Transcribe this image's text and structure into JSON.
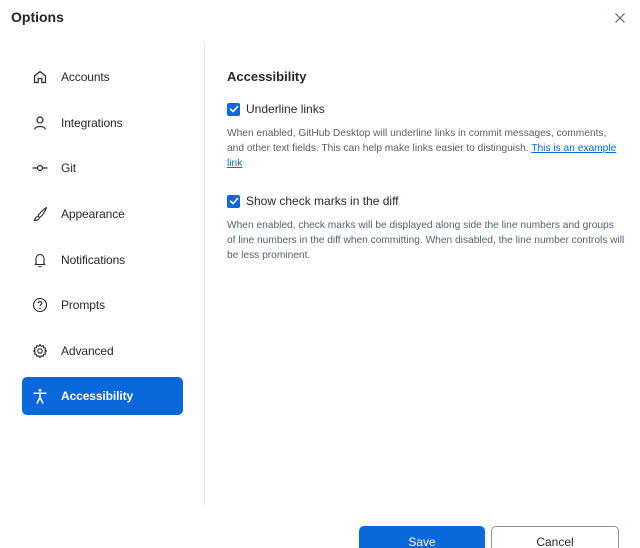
{
  "dialog": {
    "title": "Options"
  },
  "sidebar": {
    "items": [
      {
        "label": "Accounts",
        "icon": "home-icon"
      },
      {
        "label": "Integrations",
        "icon": "person-icon"
      },
      {
        "label": "Git",
        "icon": "git-commit-icon"
      },
      {
        "label": "Appearance",
        "icon": "paintbrush-icon"
      },
      {
        "label": "Notifications",
        "icon": "bell-icon"
      },
      {
        "label": "Prompts",
        "icon": "question-icon"
      },
      {
        "label": "Advanced",
        "icon": "gear-icon"
      },
      {
        "label": "Accessibility",
        "icon": "accessibility-icon",
        "selected": true
      }
    ]
  },
  "content": {
    "heading": "Accessibility",
    "options": [
      {
        "label": "Underline links",
        "checked": true,
        "description": "When enabled, GitHub Desktop will underline links in commit messages, comments, and other text fields. This can help make links easier to distinguish.",
        "link_text": "This is an example link"
      },
      {
        "label": "Show check marks in the diff",
        "checked": true,
        "description": "When enabled, check marks will be displayed along side the line numbers and groups of line numbers in the diff when committing. When disabled, the line number controls will be less prominent."
      }
    ]
  },
  "footer": {
    "save_label": "Save",
    "cancel_label": "Cancel"
  },
  "colors": {
    "accent": "#0969da",
    "text": "#24292e",
    "muted": "#57606a"
  }
}
